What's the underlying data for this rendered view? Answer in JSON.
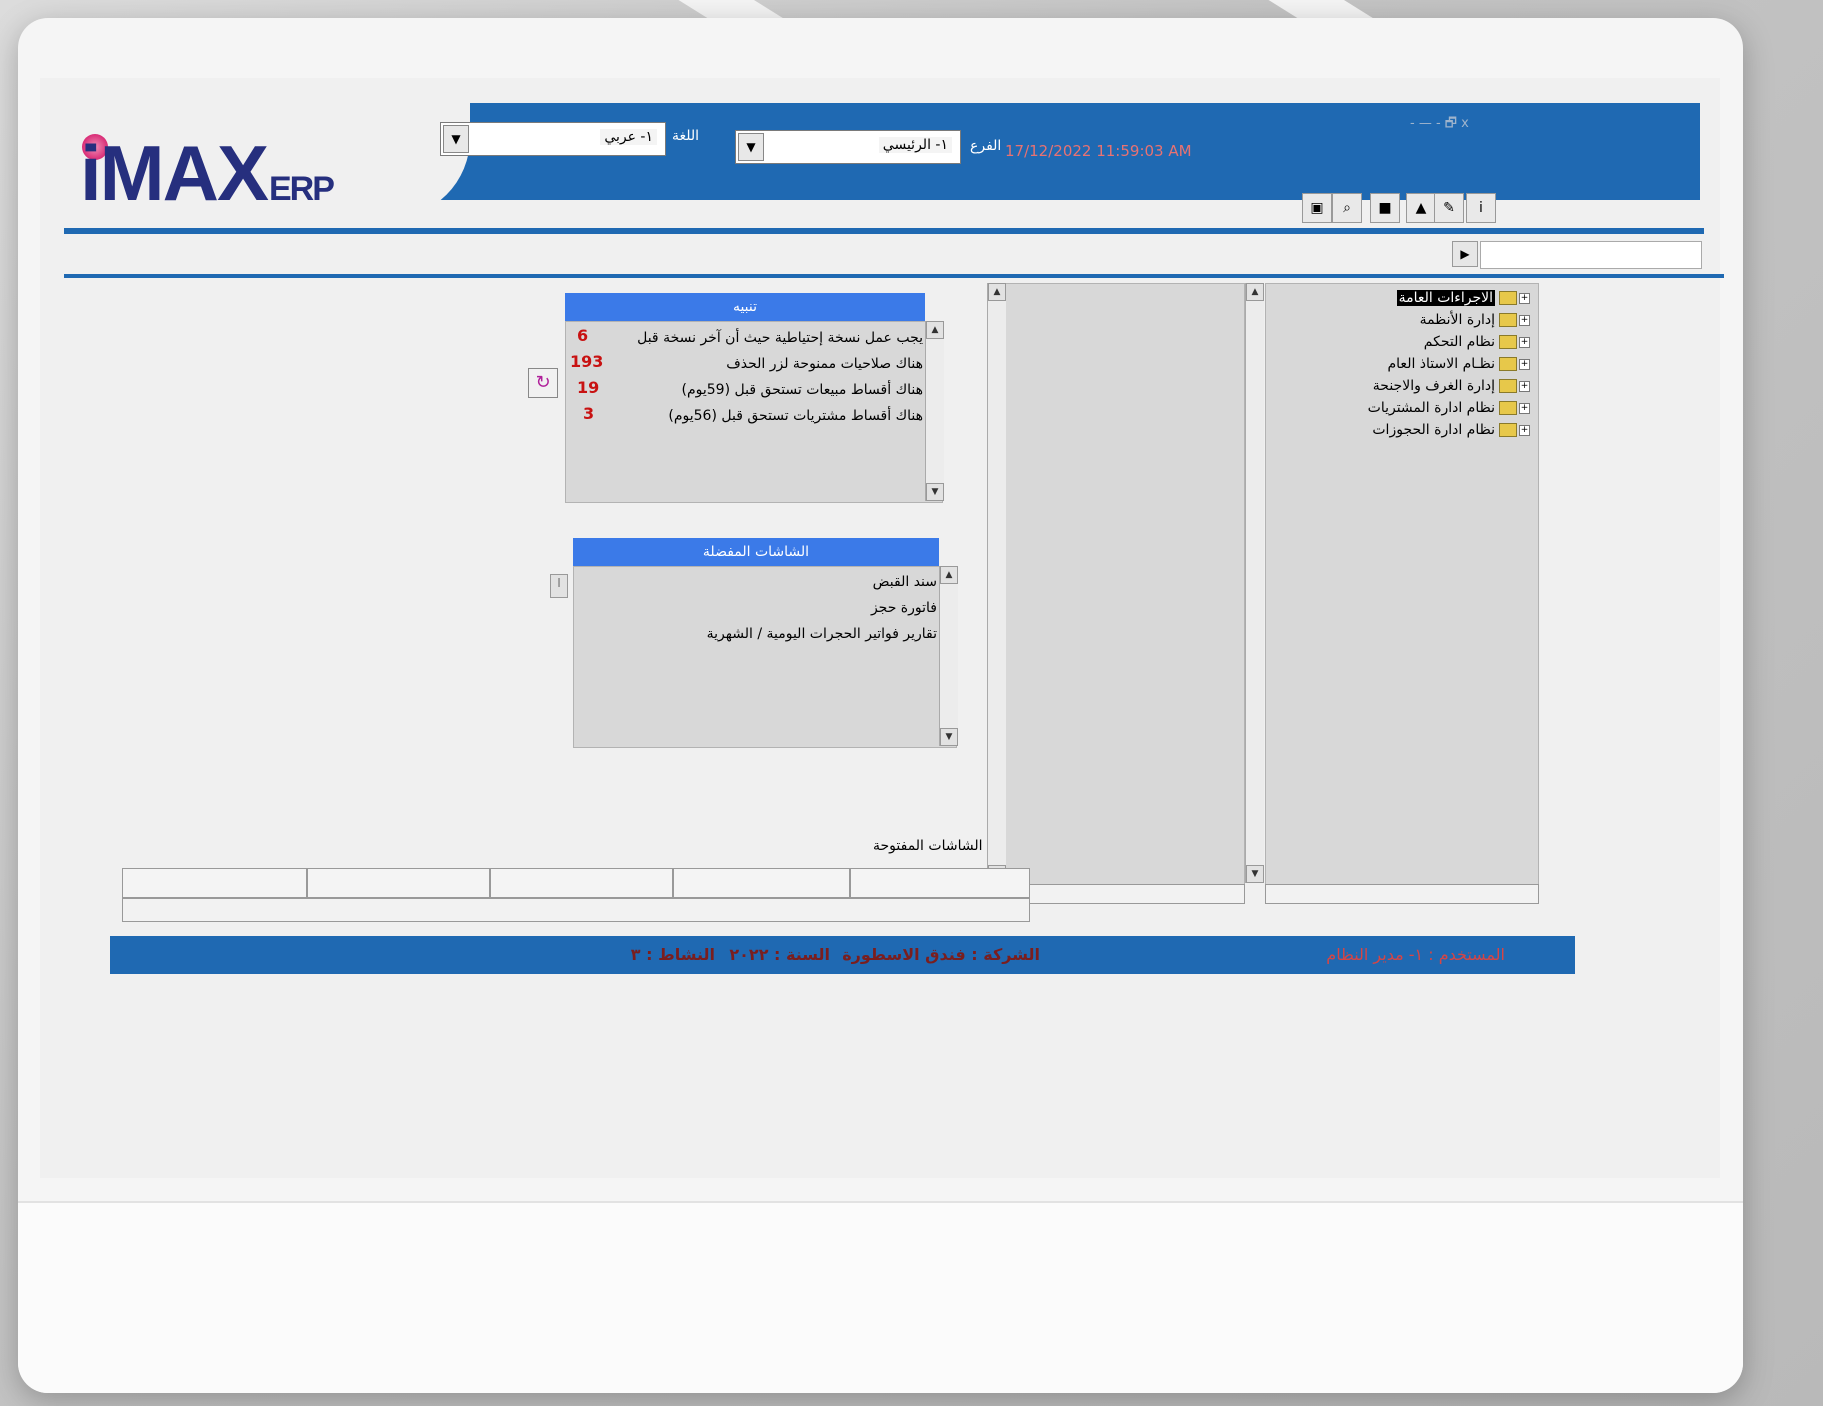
{
  "app": {
    "logo_main": "iMAX",
    "logo_suffix": "ERP"
  },
  "header": {
    "language_label": "اللغة",
    "language_value": "١- عربي",
    "branch_label": "الفرع",
    "branch_value": "١- الرئيسي",
    "datetime": "17/12/2022 11:59:03 AM",
    "window_controls": "- — - 🗗 x"
  },
  "toolbar": {
    "icons": [
      "open-folder-icon",
      "search-icon",
      "lock-icon",
      "network-icon",
      "tools-icon",
      "info-icon"
    ]
  },
  "tree": {
    "items": [
      "الاجراءات العامة",
      "إدارة الأنظمة",
      "نظام التحكم",
      "نظـام الاستاذ العام",
      "إدارة الغرف والاجنحة",
      "نظام ادارة المشتريات",
      "نظام ادارة الحجوزات"
    ]
  },
  "alerts": {
    "title": "تنبيه",
    "rows": [
      {
        "text": "يجب عمل نسخة إحتياطية حيث أن آخر نسخة قبل",
        "count": "6"
      },
      {
        "text": "هناك صلاحيات ممنوحة لزر الحذف",
        "count": "193"
      },
      {
        "text": "هناك أقساط مبيعات تستحق قبل (59يوم)",
        "count": "19"
      },
      {
        "text": "هناك أقساط مشتريات تستحق قبل (56يوم)",
        "count": "3"
      }
    ]
  },
  "favorites": {
    "title": "الشاشات المفضلة",
    "items": [
      "سند القبض",
      "فاتورة حجز",
      "تقارير فواتير الحجرات اليومية / الشهرية"
    ]
  },
  "open_screens": {
    "label": "الشاشات المفتوحة"
  },
  "status_bar": {
    "user": "المستخدم : ١- مدير النظام",
    "company": "الشركة : فندق الاسطورة",
    "year": "السنة : ٢٠٢٢",
    "activity": "النشاط : ٣"
  },
  "colors": {
    "brand_blue": "#1f69b2",
    "section_blue": "#3b7ae8",
    "alert_red": "#c81212",
    "logo_navy": "#262f7e",
    "logo_pink": "#e0317b"
  }
}
